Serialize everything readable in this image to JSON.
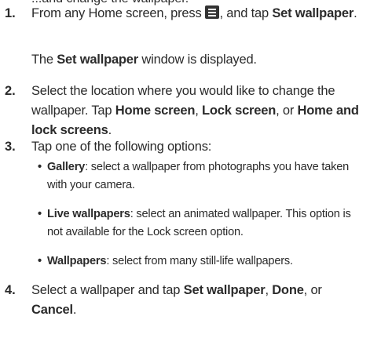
{
  "cutoff_line": "...and change the wallpaper.",
  "steps": [
    {
      "num": "1.",
      "a": "From any Home screen, press",
      "b": "and tap",
      "c": "Set wallpaper",
      "d": ".",
      "note_a": "The",
      "note_b": "Set wallpaper",
      "note_c": "window is displayed."
    },
    {
      "num": "2.",
      "a": "Select the location where you would like to change the wallpaper. Tap",
      "b": "Home screen",
      "c": ",",
      "d": "Lock screen",
      "e": ", or",
      "f": "Home and lock screens",
      "g": "."
    },
    {
      "num": "3.",
      "a": "Tap one of the following options:",
      "options": [
        {
          "term": "Gallery",
          "desc": ": select a wallpaper from photographs you have taken",
          "desc2": "with your camera."
        },
        {
          "term": "Live wallpapers",
          "desc": ": select an animated wallpaper. This option is",
          "desc2": "not available for the Lock screen option."
        },
        {
          "term": "Wallpapers",
          "desc": ": select from many still-life wallpapers.",
          "desc2": ""
        }
      ]
    },
    {
      "num": "4.",
      "a": "Select a wallpaper and tap",
      "b": "Set wallpaper",
      "c": ",",
      "d": "Done",
      "e": ", or",
      "f": "Cancel",
      "g": "."
    }
  ],
  "bullet_glyph": "•",
  "icon": "menu-icon"
}
